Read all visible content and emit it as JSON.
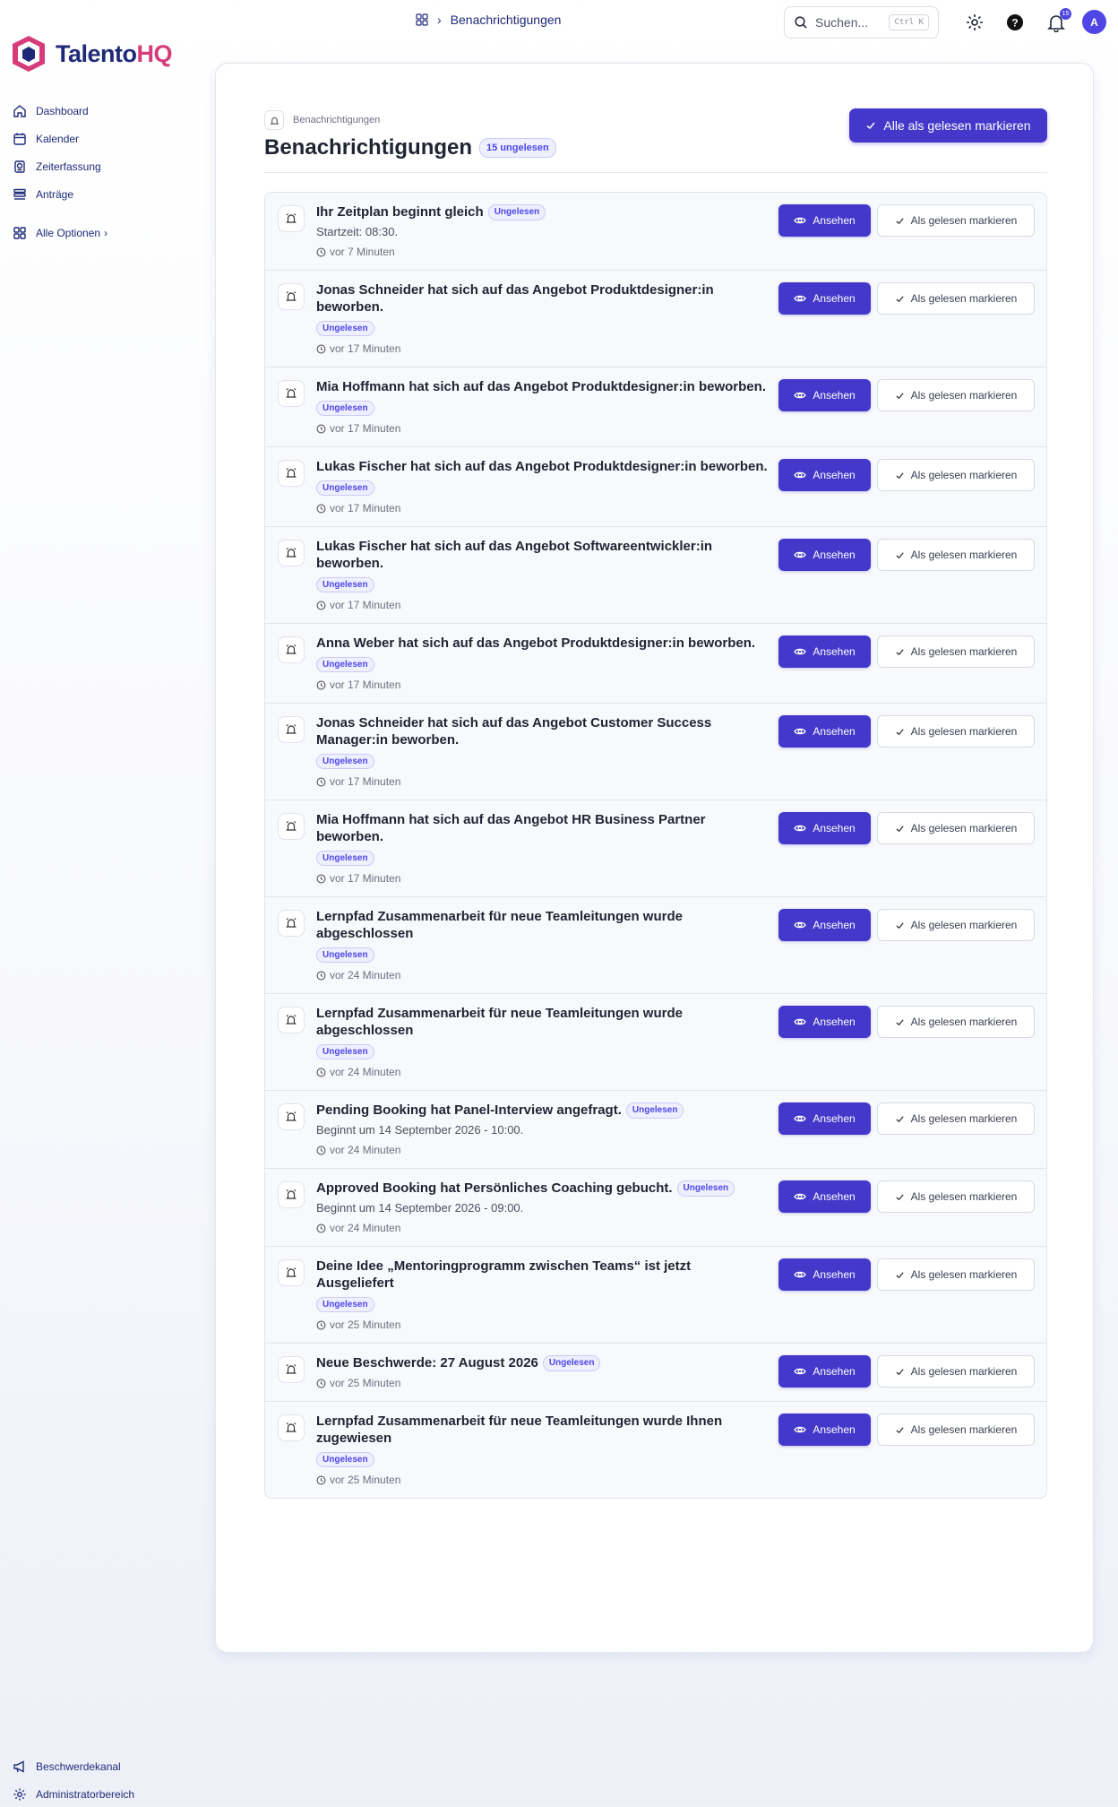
{
  "brand": {
    "part1": "Talento",
    "part2": "HQ",
    "primary_color": "#1e2a78",
    "accent_color": "#d63b7a",
    "button_color": "#4338ca"
  },
  "sidebar": {
    "items": [
      {
        "label": "Dashboard",
        "icon": "home-icon"
      },
      {
        "label": "Kalender",
        "icon": "calendar-icon"
      },
      {
        "label": "Zeiterfassung",
        "icon": "clock-list-icon"
      },
      {
        "label": "Anträge",
        "icon": "list-icon"
      }
    ],
    "all_options": "Alle Optionen",
    "bottom": [
      {
        "label": "Beschwerdekanal",
        "icon": "megaphone-icon"
      },
      {
        "label": "Administratorbereich",
        "icon": "gear-icon"
      }
    ]
  },
  "topbar": {
    "breadcrumb": "Benachrichtigungen",
    "search_placeholder": "Suchen...",
    "search_shortcut": "Ctrl K",
    "notification_count": "15",
    "avatar_initial": "A"
  },
  "page": {
    "breadcrumb": "Benachrichtigungen",
    "title": "Benachrichtigungen",
    "unread_badge": "15 ungelesen",
    "mark_all_label": "Alle als gelesen markieren",
    "view_label": "Ansehen",
    "mark_read_label": "Als gelesen markieren",
    "unread_label": "Ungelesen"
  },
  "notifications": [
    {
      "title": "Ihr Zeitplan beginnt gleich",
      "subtitle": "Startzeit: 08:30.",
      "time": "vor 7 Minuten",
      "inline_badge": true
    },
    {
      "title": "Jonas Schneider hat sich auf das Angebot Produktdesigner:in beworben.",
      "subtitle": "",
      "time": "vor 17 Minuten",
      "inline_badge": false
    },
    {
      "title": "Mia Hoffmann hat sich auf das Angebot Produktdesigner:in beworben.",
      "subtitle": "",
      "time": "vor 17 Minuten",
      "inline_badge": false
    },
    {
      "title": "Lukas Fischer hat sich auf das Angebot Produktdesigner:in beworben.",
      "subtitle": "",
      "time": "vor 17 Minuten",
      "inline_badge": false
    },
    {
      "title": "Lukas Fischer hat sich auf das Angebot Softwareentwickler:in beworben.",
      "subtitle": "",
      "time": "vor 17 Minuten",
      "inline_badge": false
    },
    {
      "title": "Anna Weber hat sich auf das Angebot Produktdesigner:in beworben.",
      "subtitle": "",
      "time": "vor 17 Minuten",
      "inline_badge": false
    },
    {
      "title": "Jonas Schneider hat sich auf das Angebot Customer Success Manager:in beworben.",
      "subtitle": "",
      "time": "vor 17 Minuten",
      "inline_badge": false
    },
    {
      "title": "Mia Hoffmann hat sich auf das Angebot HR Business Partner beworben.",
      "subtitle": "",
      "time": "vor 17 Minuten",
      "inline_badge": false
    },
    {
      "title": "Lernpfad Zusammenarbeit für neue Teamleitungen wurde abgeschlossen",
      "subtitle": "",
      "time": "vor 24 Minuten",
      "inline_badge": false
    },
    {
      "title": "Lernpfad Zusammenarbeit für neue Teamleitungen wurde abgeschlossen",
      "subtitle": "",
      "time": "vor 24 Minuten",
      "inline_badge": false
    },
    {
      "title": "Pending Booking hat Panel-Interview angefragt.",
      "subtitle": "Beginnt um 14 September 2026 - 10:00.",
      "time": "vor 24 Minuten",
      "inline_badge": true
    },
    {
      "title": "Approved Booking hat Persönliches Coaching gebucht.",
      "subtitle": "Beginnt um 14 September 2026 - 09:00.",
      "time": "vor 24 Minuten",
      "inline_badge": true
    },
    {
      "title": "Deine Idee „Mentoringprogramm zwischen Teams“ ist jetzt Ausgeliefert",
      "subtitle": "",
      "time": "vor 25 Minuten",
      "inline_badge": false
    },
    {
      "title": "Neue Beschwerde: 27 August 2026",
      "subtitle": "",
      "time": "vor 25 Minuten",
      "inline_badge": true
    },
    {
      "title": "Lernpfad Zusammenarbeit für neue Teamleitungen wurde Ihnen zugewiesen",
      "subtitle": "",
      "time": "vor 25 Minuten",
      "inline_badge": false
    }
  ]
}
